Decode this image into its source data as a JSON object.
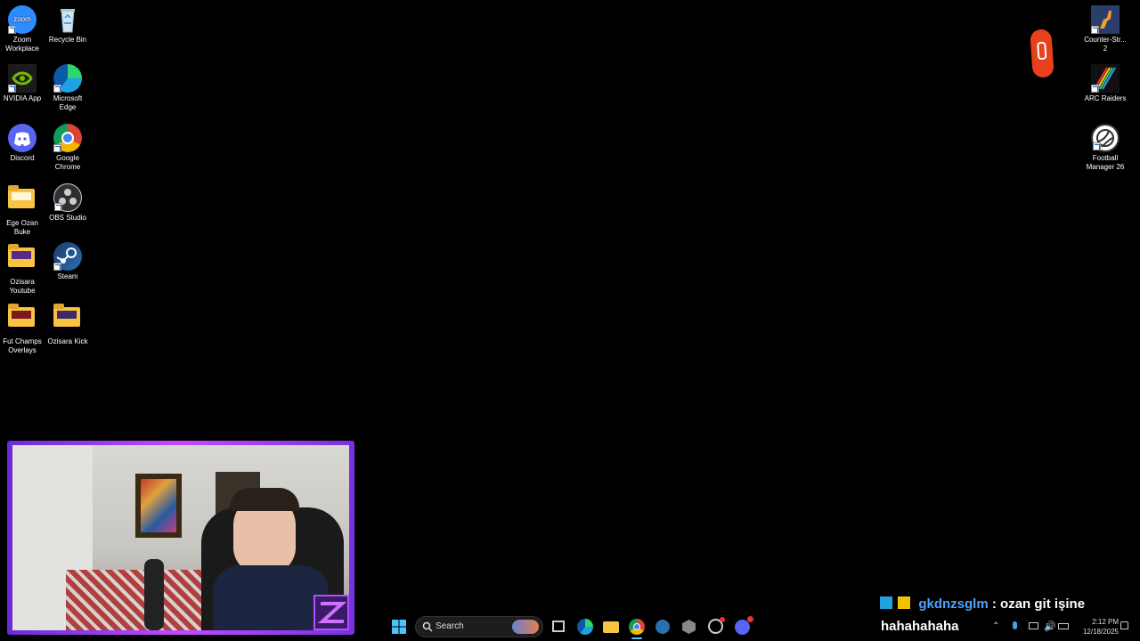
{
  "desktop_icons": [
    {
      "label": "Zoom Workplace"
    },
    {
      "label": "Recycle Bin"
    },
    {
      "label": "NVIDIA App"
    },
    {
      "label": "Microsoft Edge"
    },
    {
      "label": "Discord"
    },
    {
      "label": "Google Chrome"
    },
    {
      "label": "Ege Ozan Buke"
    },
    {
      "label": "OBS Studio"
    },
    {
      "label": "Ozisara Youtube"
    },
    {
      "label": "Steam"
    },
    {
      "label": "Fut Champs Overlays"
    },
    {
      "label": "Ozisara Kick"
    },
    {
      "label": "Counter-Str... 2"
    },
    {
      "label": "ARC Raiders"
    },
    {
      "label": "Football Manager 26"
    }
  ],
  "zoom_icon_text": "zoom",
  "chat": {
    "username": "gkdnzsglm",
    "separator": ":",
    "message": "ozan git işine",
    "line2": "hahahahaha"
  },
  "taskbar": {
    "search_label": "Search",
    "pinned": [
      "file-explorer-icon",
      "edge-icon",
      "folder-icon",
      "chrome-icon",
      "steam-icon",
      "app-icon",
      "obs-icon",
      "discord-icon"
    ]
  },
  "tray": {
    "time": "2:12 PM",
    "date": "12/18/2025"
  },
  "colors": {
    "webcam_frame": "#7a30e0",
    "username": "#4fa3ff",
    "taskbar_bg": "#000000"
  }
}
